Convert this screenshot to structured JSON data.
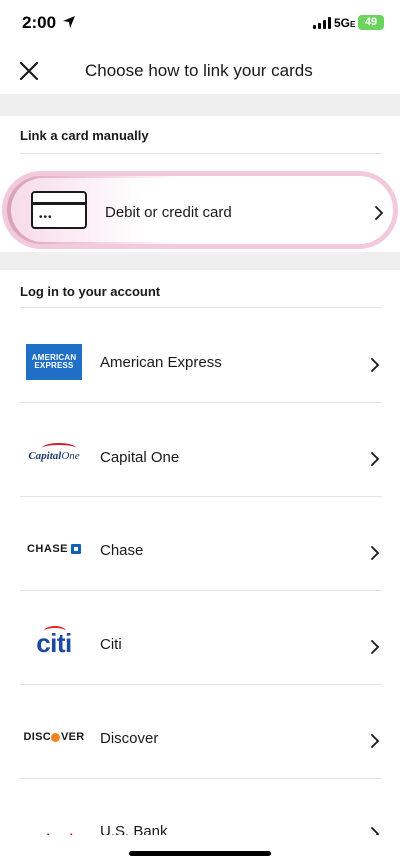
{
  "status_bar": {
    "time": "2:00",
    "network": "5G",
    "network_suffix": "E",
    "battery": "49"
  },
  "header": {
    "title": "Choose how to link your cards",
    "close_icon": "close-icon"
  },
  "manual_section": {
    "heading": "Link a card manually",
    "item": {
      "label": "Debit or credit card",
      "icon": "credit-card-icon"
    }
  },
  "login_section": {
    "heading": "Log in to your account",
    "banks": [
      {
        "name": "American Express",
        "logo_text": "AMERICAN EXPRESS"
      },
      {
        "name": "Capital One",
        "logo_text": "CapitalOne"
      },
      {
        "name": "Chase",
        "logo_text": "CHASE"
      },
      {
        "name": "Citi",
        "logo_text": "citi"
      },
      {
        "name": "Discover",
        "logo_text": "DISCOVER"
      },
      {
        "name": "U.S. Bank",
        "logo_text": "usbank"
      }
    ]
  },
  "colors": {
    "amex_blue": "#1f6fc6",
    "highlight_pink": "#f3c9dc",
    "divider": "#e3e3e3"
  }
}
